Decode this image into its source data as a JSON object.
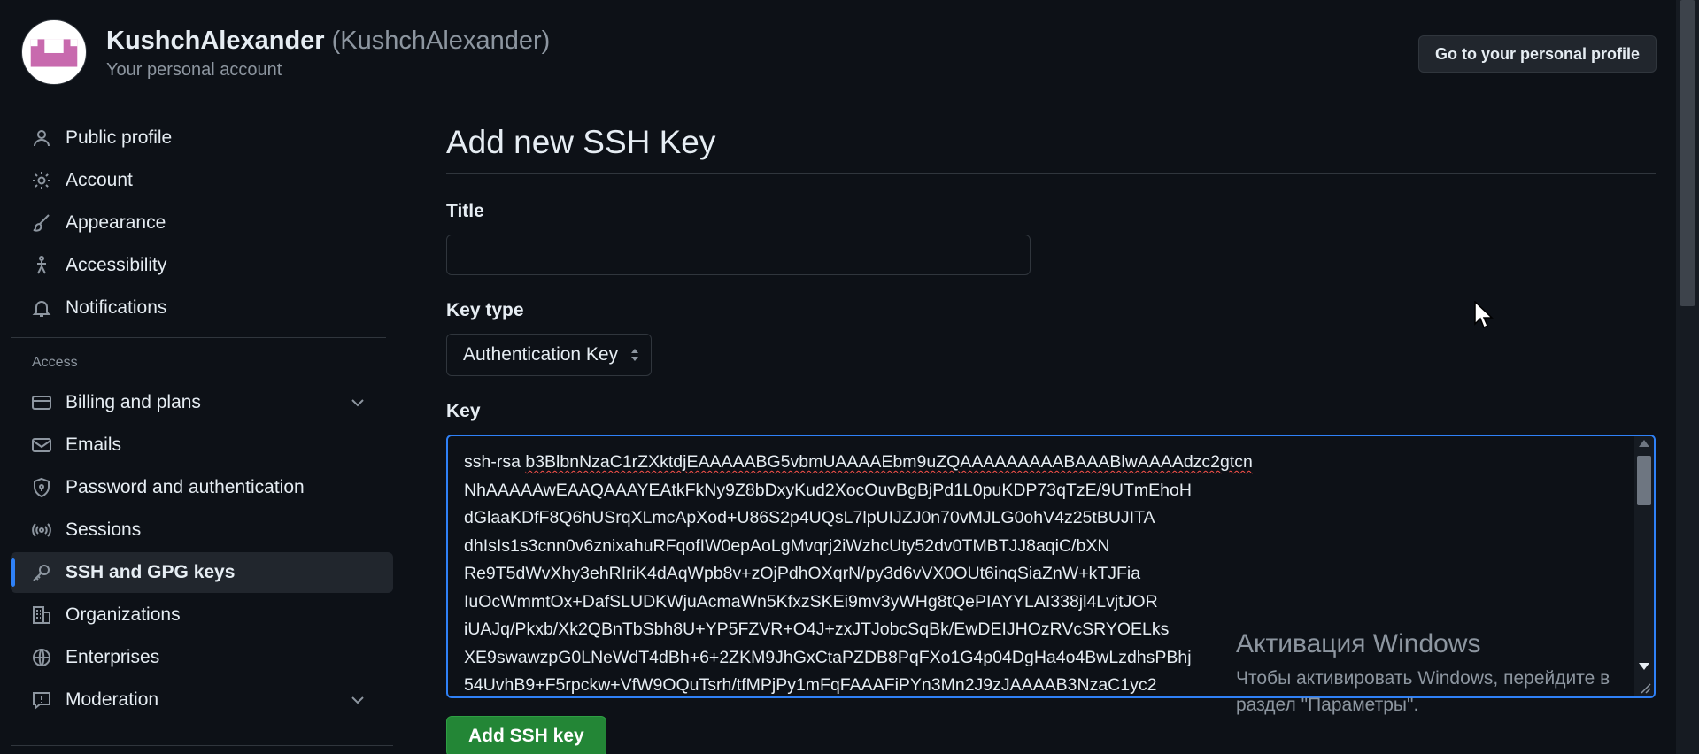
{
  "account": {
    "display_name": "KushchAlexander",
    "login": "(KushchAlexander)",
    "subtitle": "Your personal account",
    "profile_button": "Go to your personal profile"
  },
  "sidebar": {
    "items_top": [
      {
        "label": "Public profile",
        "icon": "person-icon"
      },
      {
        "label": "Account",
        "icon": "gear-icon"
      },
      {
        "label": "Appearance",
        "icon": "paintbrush-icon"
      },
      {
        "label": "Accessibility",
        "icon": "accessibility-icon"
      },
      {
        "label": "Notifications",
        "icon": "bell-icon"
      }
    ],
    "access_label": "Access",
    "items_access": [
      {
        "label": "Billing and plans",
        "icon": "credit-card-icon",
        "expandable": true
      },
      {
        "label": "Emails",
        "icon": "mail-icon"
      },
      {
        "label": "Password and authentication",
        "icon": "shield-lock-icon"
      },
      {
        "label": "Sessions",
        "icon": "broadcast-icon"
      },
      {
        "label": "SSH and GPG keys",
        "icon": "key-icon",
        "active": true
      },
      {
        "label": "Organizations",
        "icon": "organization-icon"
      },
      {
        "label": "Enterprises",
        "icon": "globe-icon"
      },
      {
        "label": "Moderation",
        "icon": "report-icon",
        "expandable": true
      }
    ]
  },
  "form": {
    "heading": "Add new SSH Key",
    "title_label": "Title",
    "title_value": "",
    "key_type_label": "Key type",
    "key_type_value": "Authentication Key",
    "key_label": "Key",
    "key_prefix": "ssh-rsa ",
    "key_lines": [
      "b3BlbnNzaC1rZXktdjEAAAAABG5vbmUAAAAEbm9uZQAAAAAAAAABAAABlwAAAAdzc2gtcn",
      "NhAAAAAwEAAQAAAYEAtkFkNy9Z8bDxyKud2XocOuvBgBjPd1L0puKDP73qTzE/9UTmEhoH",
      "dGlaaKDfF8Q6hUSrqXLmcApXod+U86S2p4UQsL7lpUIJZJ0n70vMJLG0ohV4z25tBUJITA",
      "dhIsIs1s3cnn0v6znixahuRFqofIW0epAoLgMvqrj2iWzhcUty52dv0TMBTJJ8aqiC/bXN",
      "Re9T5dWvXhy3ehRIriK4dAqWpb8v+zOjPdhOXqrN/py3d6vVX0OUt6inqSiaZnW+kTJFia",
      "IuOcWmmtOx+DafSLUDKWjuAcmaWn5KfxzSKEi9mv3yWHg8tQePIAYYLAI338jl4LvjtJOR",
      "iUAJq/Pkxb/Xk2QBnTbSbh8U+YP5FZVR+O4J+zxJTJobcSqBk/EwDEIJHOzRVcSRYOELks",
      "XE9swawzpG0LNeWdT4dBh+6+2ZKM9JhGxCtaPZDB8PqFXo1G4p04DgHa4o4BwLzdhsPBhj",
      "54UvhB9+F5rpckw+VfW9OQuTsrh/tfMPjPy1mFqFAAAFiPYn3Mn2J9zJAAAAB3NzaC1yc2"
    ],
    "submit_label": "Add SSH key"
  },
  "windows_watermark": {
    "title": "Активация Windows",
    "body": "Чтобы активировать Windows, перейдите в раздел \"Параметры\"."
  },
  "colors": {
    "background": "#0d1117",
    "accent_blue": "#2f81f7",
    "button_green": "#238636",
    "avatar_pink": "#c86aae"
  }
}
